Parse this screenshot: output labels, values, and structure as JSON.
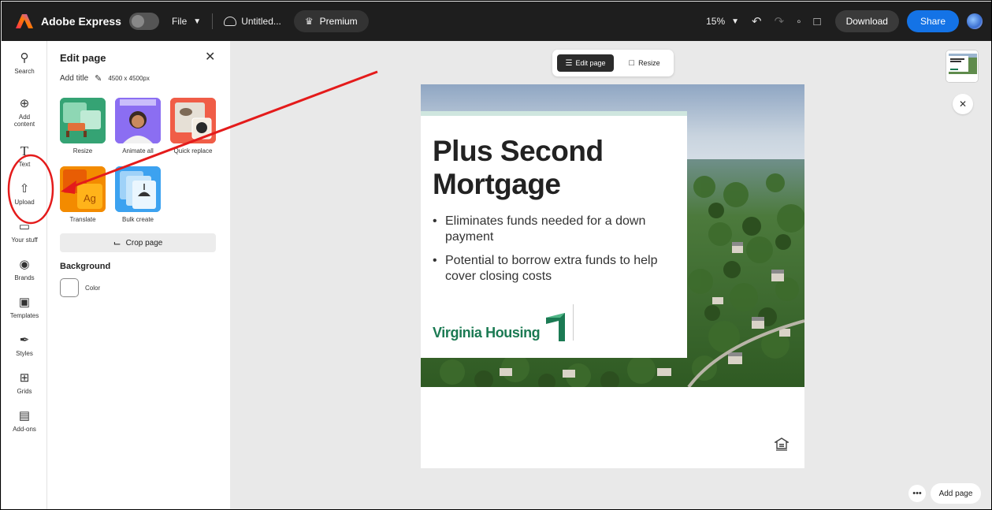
{
  "topbar": {
    "app_name": "Adobe Express",
    "file_menu": "File",
    "doc_name": "Untitled...",
    "premium": "Premium",
    "zoom": "15%",
    "download": "Download",
    "share": "Share"
  },
  "rail": {
    "items": [
      {
        "label": "Search",
        "icon": "search-icon"
      },
      {
        "label": "Add content",
        "icon": "plus-circle-icon"
      },
      {
        "label": "Text",
        "icon": "text-icon"
      },
      {
        "label": "Upload",
        "icon": "upload-icon"
      },
      {
        "label": "Your stuff",
        "icon": "folder-icon"
      },
      {
        "label": "Brands",
        "icon": "brands-icon"
      },
      {
        "label": "Templates",
        "icon": "templates-icon"
      },
      {
        "label": "Styles",
        "icon": "styles-icon"
      },
      {
        "label": "Grids",
        "icon": "grid-icon"
      },
      {
        "label": "Add-ons",
        "icon": "addons-icon"
      }
    ]
  },
  "panel": {
    "title": "Edit page",
    "add_title": "Add title",
    "dimensions": "4500 x 4500px",
    "tools": [
      {
        "label": "Resize"
      },
      {
        "label": "Animate all"
      },
      {
        "label": "Quick replace"
      },
      {
        "label": "Translate"
      },
      {
        "label": "Bulk create"
      }
    ],
    "crop_page": "Crop page",
    "background_heading": "Background",
    "color_label": "Color"
  },
  "canvas": {
    "toolbar": {
      "edit_page": "Edit page",
      "resize": "Resize"
    },
    "add_page": "Add page",
    "more": "•••"
  },
  "design": {
    "headline": "Plus Second Mortgage",
    "bullets": [
      "Eliminates funds needed for a down payment",
      "Potential to borrow extra funds to help cover closing costs"
    ],
    "logo_text": "Virginia Housing"
  },
  "colors": {
    "topbar_bg": "#1e1e1e",
    "share_blue": "#1473e6",
    "brand_green": "#1b7a53",
    "annotation_red": "#e41b1b"
  }
}
